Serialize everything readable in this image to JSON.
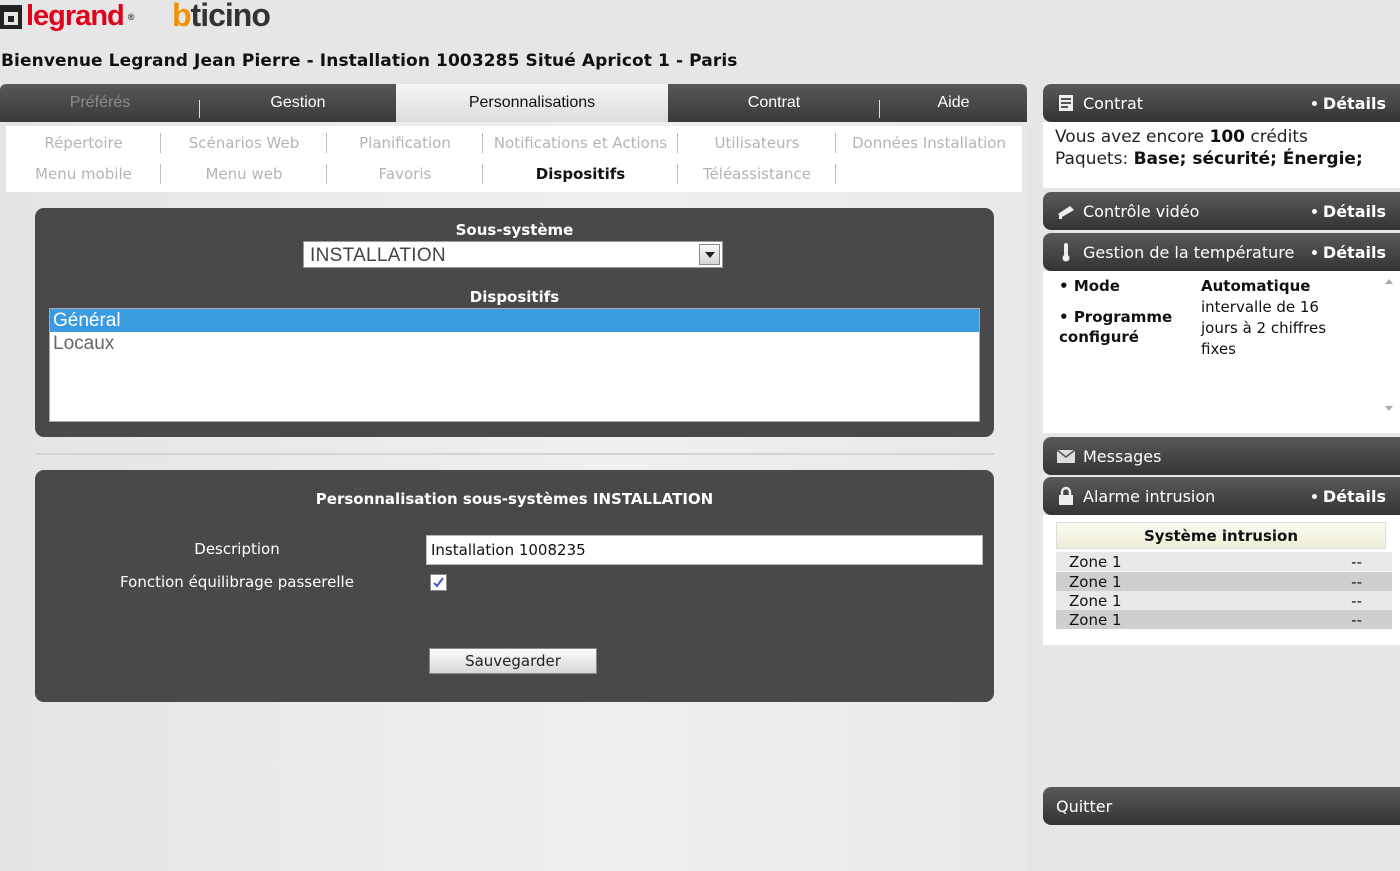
{
  "header": {
    "logo_legrand": "legrand",
    "logo_bticino": "bticino",
    "welcome": "Bienvenue Legrand Jean Pierre - Installation 1003285 Situé Apricot 1 - Paris"
  },
  "main_tabs": [
    {
      "label": "Préférés",
      "state": "disabled"
    },
    {
      "label": "Gestion",
      "state": "normal"
    },
    {
      "label": "Personnalisations",
      "state": "active"
    },
    {
      "label": "Contrat",
      "state": "normal"
    },
    {
      "label": "Aide",
      "state": "normal"
    }
  ],
  "subnav": {
    "row1": [
      "Répertoire",
      "Scénarios Web",
      "Planification",
      "Notifications et Actions",
      "Utilisateurs",
      "Données Installation"
    ],
    "row2": [
      "Menu mobile",
      "Menu web",
      "Favoris",
      "Dispositifs",
      "Téléassistance"
    ],
    "active": "Dispositifs"
  },
  "subsystem_panel": {
    "subsystem_label": "Sous-système",
    "subsystem_value": "INSTALLATION",
    "devices_label": "Dispositifs",
    "devices": [
      "Général",
      "Locaux"
    ],
    "selected_device": "Général"
  },
  "custom_panel": {
    "title": "Personnalisation sous-systèmes INSTALLATION",
    "description_label": "Description",
    "description_value": "Installation 1008235",
    "balance_label": "Fonction équilibrage passerelle",
    "balance_checked": true,
    "save_label": "Sauvegarder"
  },
  "sidebar": {
    "contrat": {
      "title": "Contrat",
      "details": "Détails",
      "line1_prefix": "Vous avez encore ",
      "line1_credits": "100",
      "line1_suffix": " crédits",
      "line2_prefix": "Paquets: ",
      "line2_packages": "Base; sécurité; Énergie;",
      "icon": "document-icon"
    },
    "video": {
      "title": "Contrôle vidéo",
      "details": "Détails",
      "icon": "camera-icon"
    },
    "temperature": {
      "title": "Gestion de la température",
      "details": "Détails",
      "icon": "thermometer-icon",
      "mode_label": "Mode",
      "mode_value": "Automatique",
      "program_label_1": "Programme",
      "program_label_2": "configuré",
      "program_value": "intervalle de 16 jours à 2 chiffres fixes"
    },
    "messages": {
      "title": "Messages",
      "icon": "envelope-icon"
    },
    "alarm": {
      "title": "Alarme intrusion",
      "details": "Détails",
      "icon": "lock-icon",
      "system_title": "Système intrusion",
      "zones": [
        {
          "name": "Zone 1",
          "status": "--"
        },
        {
          "name": "Zone 1",
          "status": "--"
        },
        {
          "name": "Zone 1",
          "status": "--"
        },
        {
          "name": "Zone 1",
          "status": "--"
        }
      ]
    },
    "quit_label": "Quitter"
  },
  "colors": {
    "legrand_red": "#e2001a",
    "bticino_orange": "#f39200",
    "panel_dark": "#494949",
    "selection_blue": "#3b9be0"
  }
}
